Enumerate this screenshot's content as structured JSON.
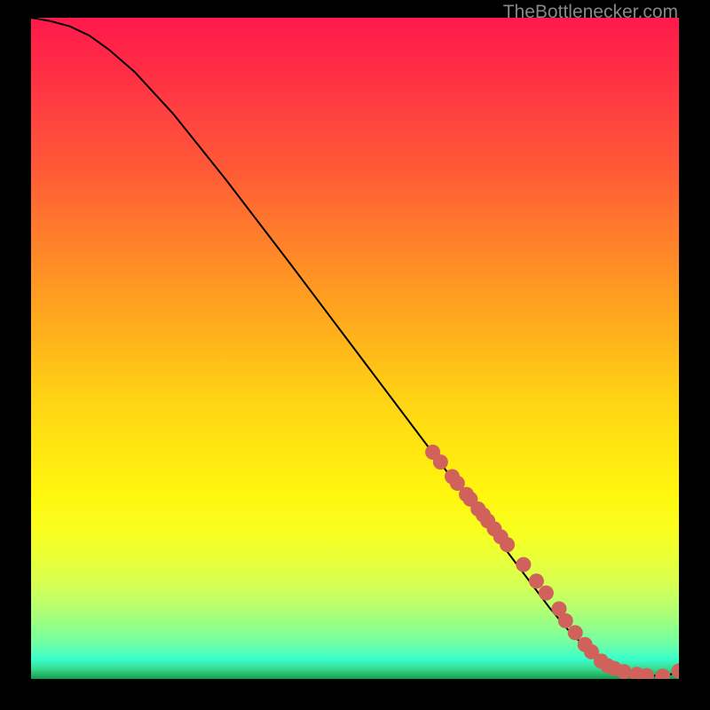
{
  "watermark": "TheBottlenecker.com",
  "colors": {
    "curve": "#000000",
    "dot_fill": "#d0615b",
    "dot_stroke": "#b84c46"
  },
  "chart_data": {
    "type": "line",
    "title": "",
    "xlabel": "",
    "ylabel": "",
    "xlim": [
      0,
      100
    ],
    "ylim": [
      0,
      100
    ],
    "curve": {
      "x": [
        0,
        3,
        6,
        9,
        12,
        16,
        22,
        30,
        40,
        50,
        60,
        68,
        73,
        77,
        80,
        83,
        86,
        90,
        94,
        98,
        100
      ],
      "y": [
        100,
        99.5,
        98.7,
        97.3,
        95.2,
        91.8,
        85.4,
        75.6,
        62.8,
        49.8,
        36.8,
        26.4,
        19.9,
        14.7,
        10.8,
        7.3,
        4.4,
        1.8,
        0.6,
        0.4,
        1.2
      ]
    },
    "series": [
      {
        "name": "data-points",
        "x": [
          62,
          63.2,
          65,
          65.8,
          67.2,
          67.8,
          69,
          69.8,
          70.5,
          71.5,
          72.5,
          73.5,
          76,
          78,
          79.5,
          81.5,
          82.5,
          84,
          85.5,
          86.5,
          88,
          89,
          90,
          91.5,
          93.5,
          95,
          97.5,
          100
        ],
        "y": [
          34.3,
          32.8,
          30.6,
          29.6,
          27.9,
          27.2,
          25.7,
          24.8,
          23.9,
          22.7,
          21.5,
          20.3,
          17.3,
          14.8,
          13,
          10.6,
          8.8,
          7,
          5.2,
          4.1,
          2.7,
          2,
          1.6,
          1.1,
          0.7,
          0.5,
          0.4,
          1.2
        ]
      }
    ]
  }
}
